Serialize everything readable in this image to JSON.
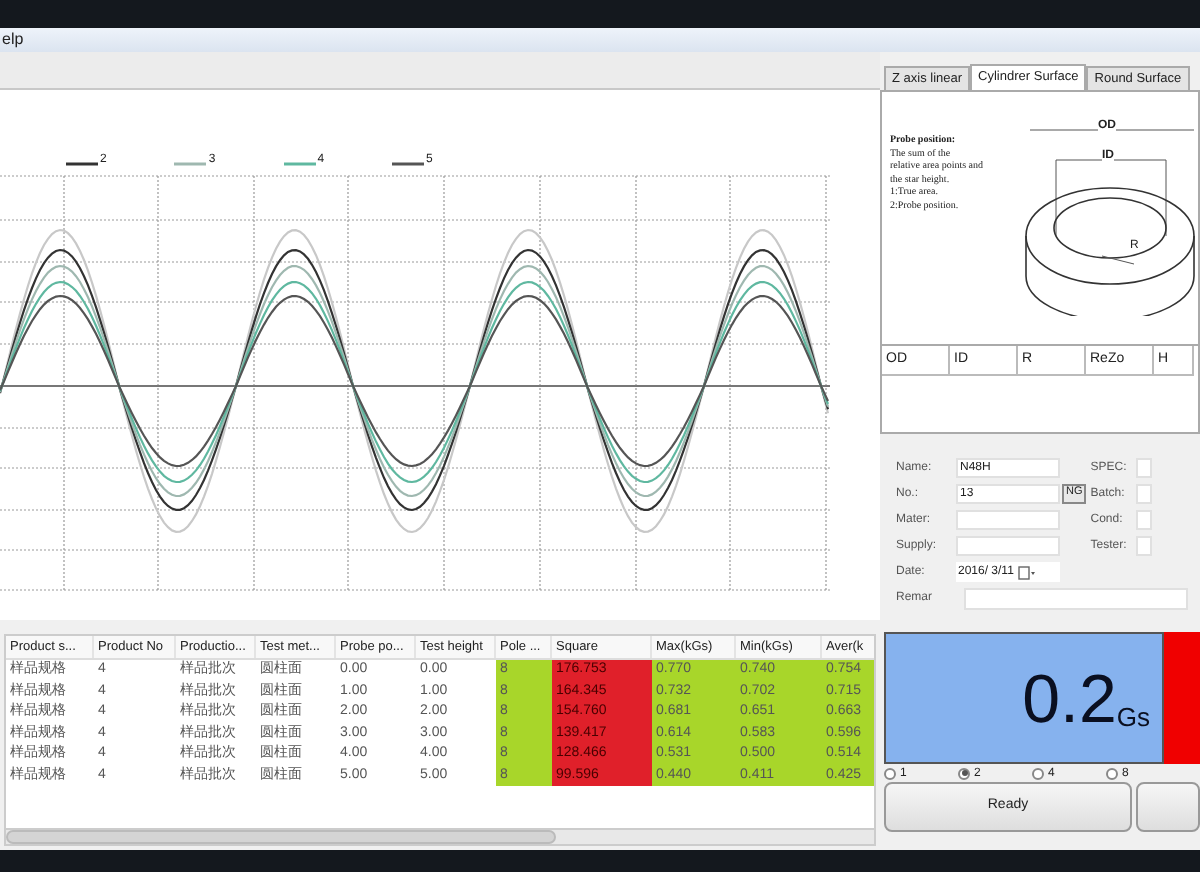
{
  "menu": {
    "label": "elp"
  },
  "legend": [
    {
      "label": "2",
      "color": "#333333"
    },
    {
      "label": "3",
      "color": "#9fb8b0"
    },
    {
      "label": "4",
      "color": "#5fb8a0"
    },
    {
      "label": "5",
      "color": "#555555"
    }
  ],
  "right_tabs": [
    {
      "label": "Z axis linear",
      "selected": false
    },
    {
      "label": "Cylindrer Surface",
      "selected": true
    },
    {
      "label": "Round Surface",
      "selected": false
    }
  ],
  "probe_note": {
    "title": "Probe position:",
    "lines": [
      "The sum of the",
      "relative area points and",
      "the star height.",
      "1:True area.",
      "2:Probe position."
    ]
  },
  "diagram_labels": {
    "od": "OD",
    "id": "ID",
    "r": "R"
  },
  "dims_table": {
    "columns": [
      "OD",
      "ID",
      "R",
      "ReZo",
      "H"
    ]
  },
  "form": {
    "left": [
      {
        "kind": "text",
        "label": "Name:",
        "value": "N48H"
      },
      {
        "kind": "text",
        "label": "No.:",
        "value": "13",
        "button": "NG"
      },
      {
        "kind": "text",
        "label": "Mater:"
      },
      {
        "kind": "text",
        "label": "Supply:"
      },
      {
        "kind": "date",
        "label": "Date:",
        "value": "2016/ 3/11"
      }
    ],
    "right": [
      "SPEC:",
      "Batch:",
      "Cond:",
      "Tester:"
    ],
    "remark": {
      "label": "Remar"
    }
  },
  "results_table": {
    "columns": [
      {
        "label": "Product s..."
      },
      {
        "label": "Product No"
      },
      {
        "label": "Productio..."
      },
      {
        "label": "Test met..."
      },
      {
        "label": "Probe po..."
      },
      {
        "label": "Test height"
      },
      {
        "label": "Pole ...",
        "color": "#a8d62a"
      },
      {
        "label": "Square",
        "color": "#e0202a"
      },
      {
        "label": "Max(kGs)",
        "color": "#a8d62a"
      },
      {
        "label": "Min(kGs)",
        "color": "#a8d62a"
      },
      {
        "label": "Aver(k",
        "color": "#a8d62a"
      }
    ],
    "rows": [
      [
        "样品规格",
        "4",
        "样品批次",
        "圆柱面",
        "0.00",
        "0.00",
        "8",
        "176.753",
        "0.770",
        "0.740",
        "0.754"
      ],
      [
        "样品规格",
        "4",
        "样品批次",
        "圆柱面",
        "1.00",
        "1.00",
        "8",
        "164.345",
        "0.732",
        "0.702",
        "0.715"
      ],
      [
        "样品规格",
        "4",
        "样品批次",
        "圆柱面",
        "2.00",
        "2.00",
        "8",
        "154.760",
        "0.681",
        "0.651",
        "0.663"
      ],
      [
        "样品规格",
        "4",
        "样品批次",
        "圆柱面",
        "3.00",
        "3.00",
        "8",
        "139.417",
        "0.614",
        "0.583",
        "0.596"
      ],
      [
        "样品规格",
        "4",
        "样品批次",
        "圆柱面",
        "4.00",
        "4.00",
        "8",
        "128.466",
        "0.531",
        "0.500",
        "0.514"
      ],
      [
        "样品规格",
        "4",
        "样品批次",
        "圆柱面",
        "5.00",
        "5.00",
        "8",
        "99.596",
        "0.440",
        "0.411",
        "0.425"
      ]
    ]
  },
  "display": {
    "value": "0.2",
    "unit": "Gs"
  },
  "radios": [
    {
      "label": "1",
      "selected": false
    },
    {
      "label": "2",
      "selected": true
    },
    {
      "label": "4",
      "selected": false
    },
    {
      "label": "8",
      "selected": false
    }
  ],
  "buttons": [
    "Ready"
  ]
}
